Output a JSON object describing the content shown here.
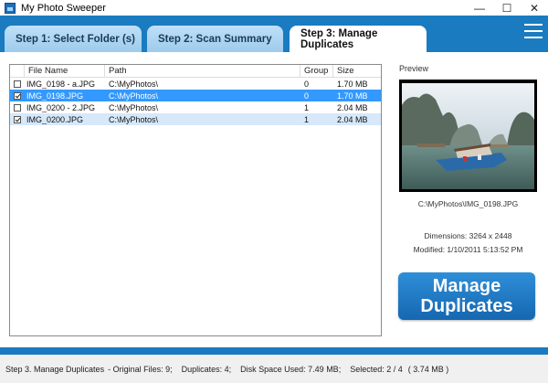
{
  "window": {
    "title": "My Photo Sweeper",
    "controls": [
      "minimize",
      "maximize",
      "close"
    ]
  },
  "tabs": [
    {
      "label": "Step 1: Select Folder (s)",
      "active": false
    },
    {
      "label": "Step 2: Scan Summary",
      "active": false
    },
    {
      "label": "Step 3: Manage Duplicates",
      "active": true
    }
  ],
  "menu_icon": "hamburger-icon",
  "file_list": {
    "columns": [
      "File Name",
      "Path",
      "Group",
      "Size"
    ],
    "rows": [
      {
        "checked": false,
        "name": "IMG_0198 - a.JPG",
        "path": "C:\\MyPhotos\\",
        "group": "0",
        "size": "1.70 MB",
        "state": "normal"
      },
      {
        "checked": true,
        "name": "IMG_0198.JPG",
        "path": "C:\\MyPhotos\\",
        "group": "0",
        "size": "1.70 MB",
        "state": "selected"
      },
      {
        "checked": false,
        "name": "IMG_0200 - 2.JPG",
        "path": "C:\\MyPhotos\\",
        "group": "1",
        "size": "2.04 MB",
        "state": "normal"
      },
      {
        "checked": true,
        "name": "IMG_0200.JPG",
        "path": "C:\\MyPhotos\\",
        "group": "1",
        "size": "2.04 MB",
        "state": "light"
      }
    ]
  },
  "preview": {
    "label": "Preview",
    "path": "C:\\MyPhotos\\IMG_0198.JPG",
    "dimensions": "Dimensions: 3264 x 2448",
    "modified": "Modified: 1/10/2011 5:13:52 PM"
  },
  "manage_button": {
    "line1": "Manage",
    "line2": "Duplicates"
  },
  "status": {
    "step": "Step 3. Manage Duplicates",
    "original_files": "- Original Files: 9;",
    "duplicates": "Duplicates: 4;",
    "disk_space": "Disk Space Used: 7.49 MB;",
    "selected": "Selected: 2 / 4",
    "selected_size": "( 3.74 MB )"
  },
  "colors": {
    "accent": "#1a7bc0",
    "selection": "#3399ff",
    "button": "#1e7cc6"
  }
}
